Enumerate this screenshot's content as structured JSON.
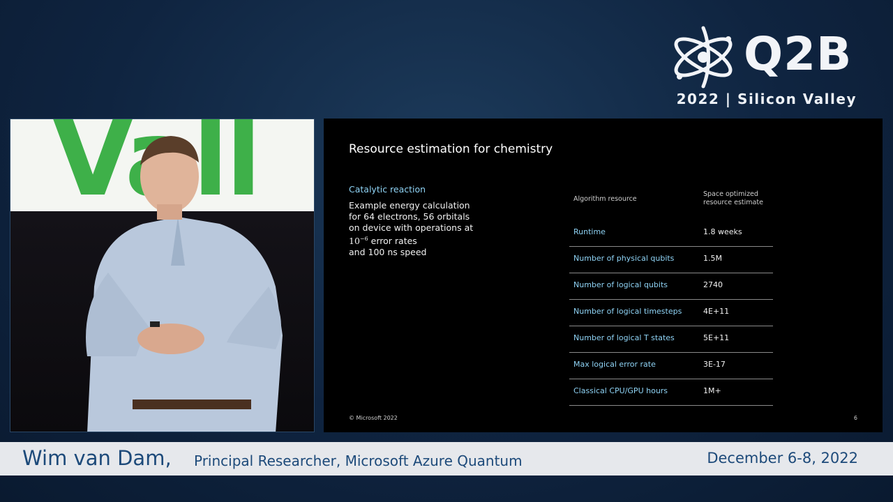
{
  "brand": {
    "name": "Q2B",
    "subtitle": "2022 | Silicon Valley",
    "logo_icon": "atom-logo-icon"
  },
  "video": {
    "backdrop_text": "Vall"
  },
  "slide": {
    "title": "Resource estimation for chemistry",
    "subtitle": "Catalytic reaction",
    "body_lines": [
      "Example energy calculation",
      "for 64 electrons, 56 orbitals",
      "on device with operations at"
    ],
    "math_base": "10",
    "math_exponent": "−6",
    "error_rates_text": " error rates",
    "speed_line": "and 100 ns speed",
    "table": {
      "header_resource": "Algorithm resource",
      "header_estimate_line1": "Space optimized",
      "header_estimate_line2": "resource estimate",
      "rows": [
        {
          "label": "Runtime",
          "value": "1.8 weeks"
        },
        {
          "label": "Number of physical qubits",
          "value": "1.5M"
        },
        {
          "label": "Number of logical qubits",
          "value": "2740"
        },
        {
          "label": "Number of logical timesteps",
          "value": "4E+11"
        },
        {
          "label": "Number of logical T states",
          "value": "5E+11"
        },
        {
          "label": "Max logical error rate",
          "value": "3E-17"
        },
        {
          "label": "Classical CPU/GPU hours",
          "value": "1M+"
        }
      ]
    },
    "footer": "© Microsoft 2022",
    "page_number": "6",
    "label_color": "#8fd3f5"
  },
  "lower_third": {
    "speaker_name": "Wim van Dam,",
    "speaker_title": "Principal Researcher, Microsoft Azure Quantum",
    "event_date": "December 6-8, 2022",
    "text_color": "#1d4a7a"
  }
}
